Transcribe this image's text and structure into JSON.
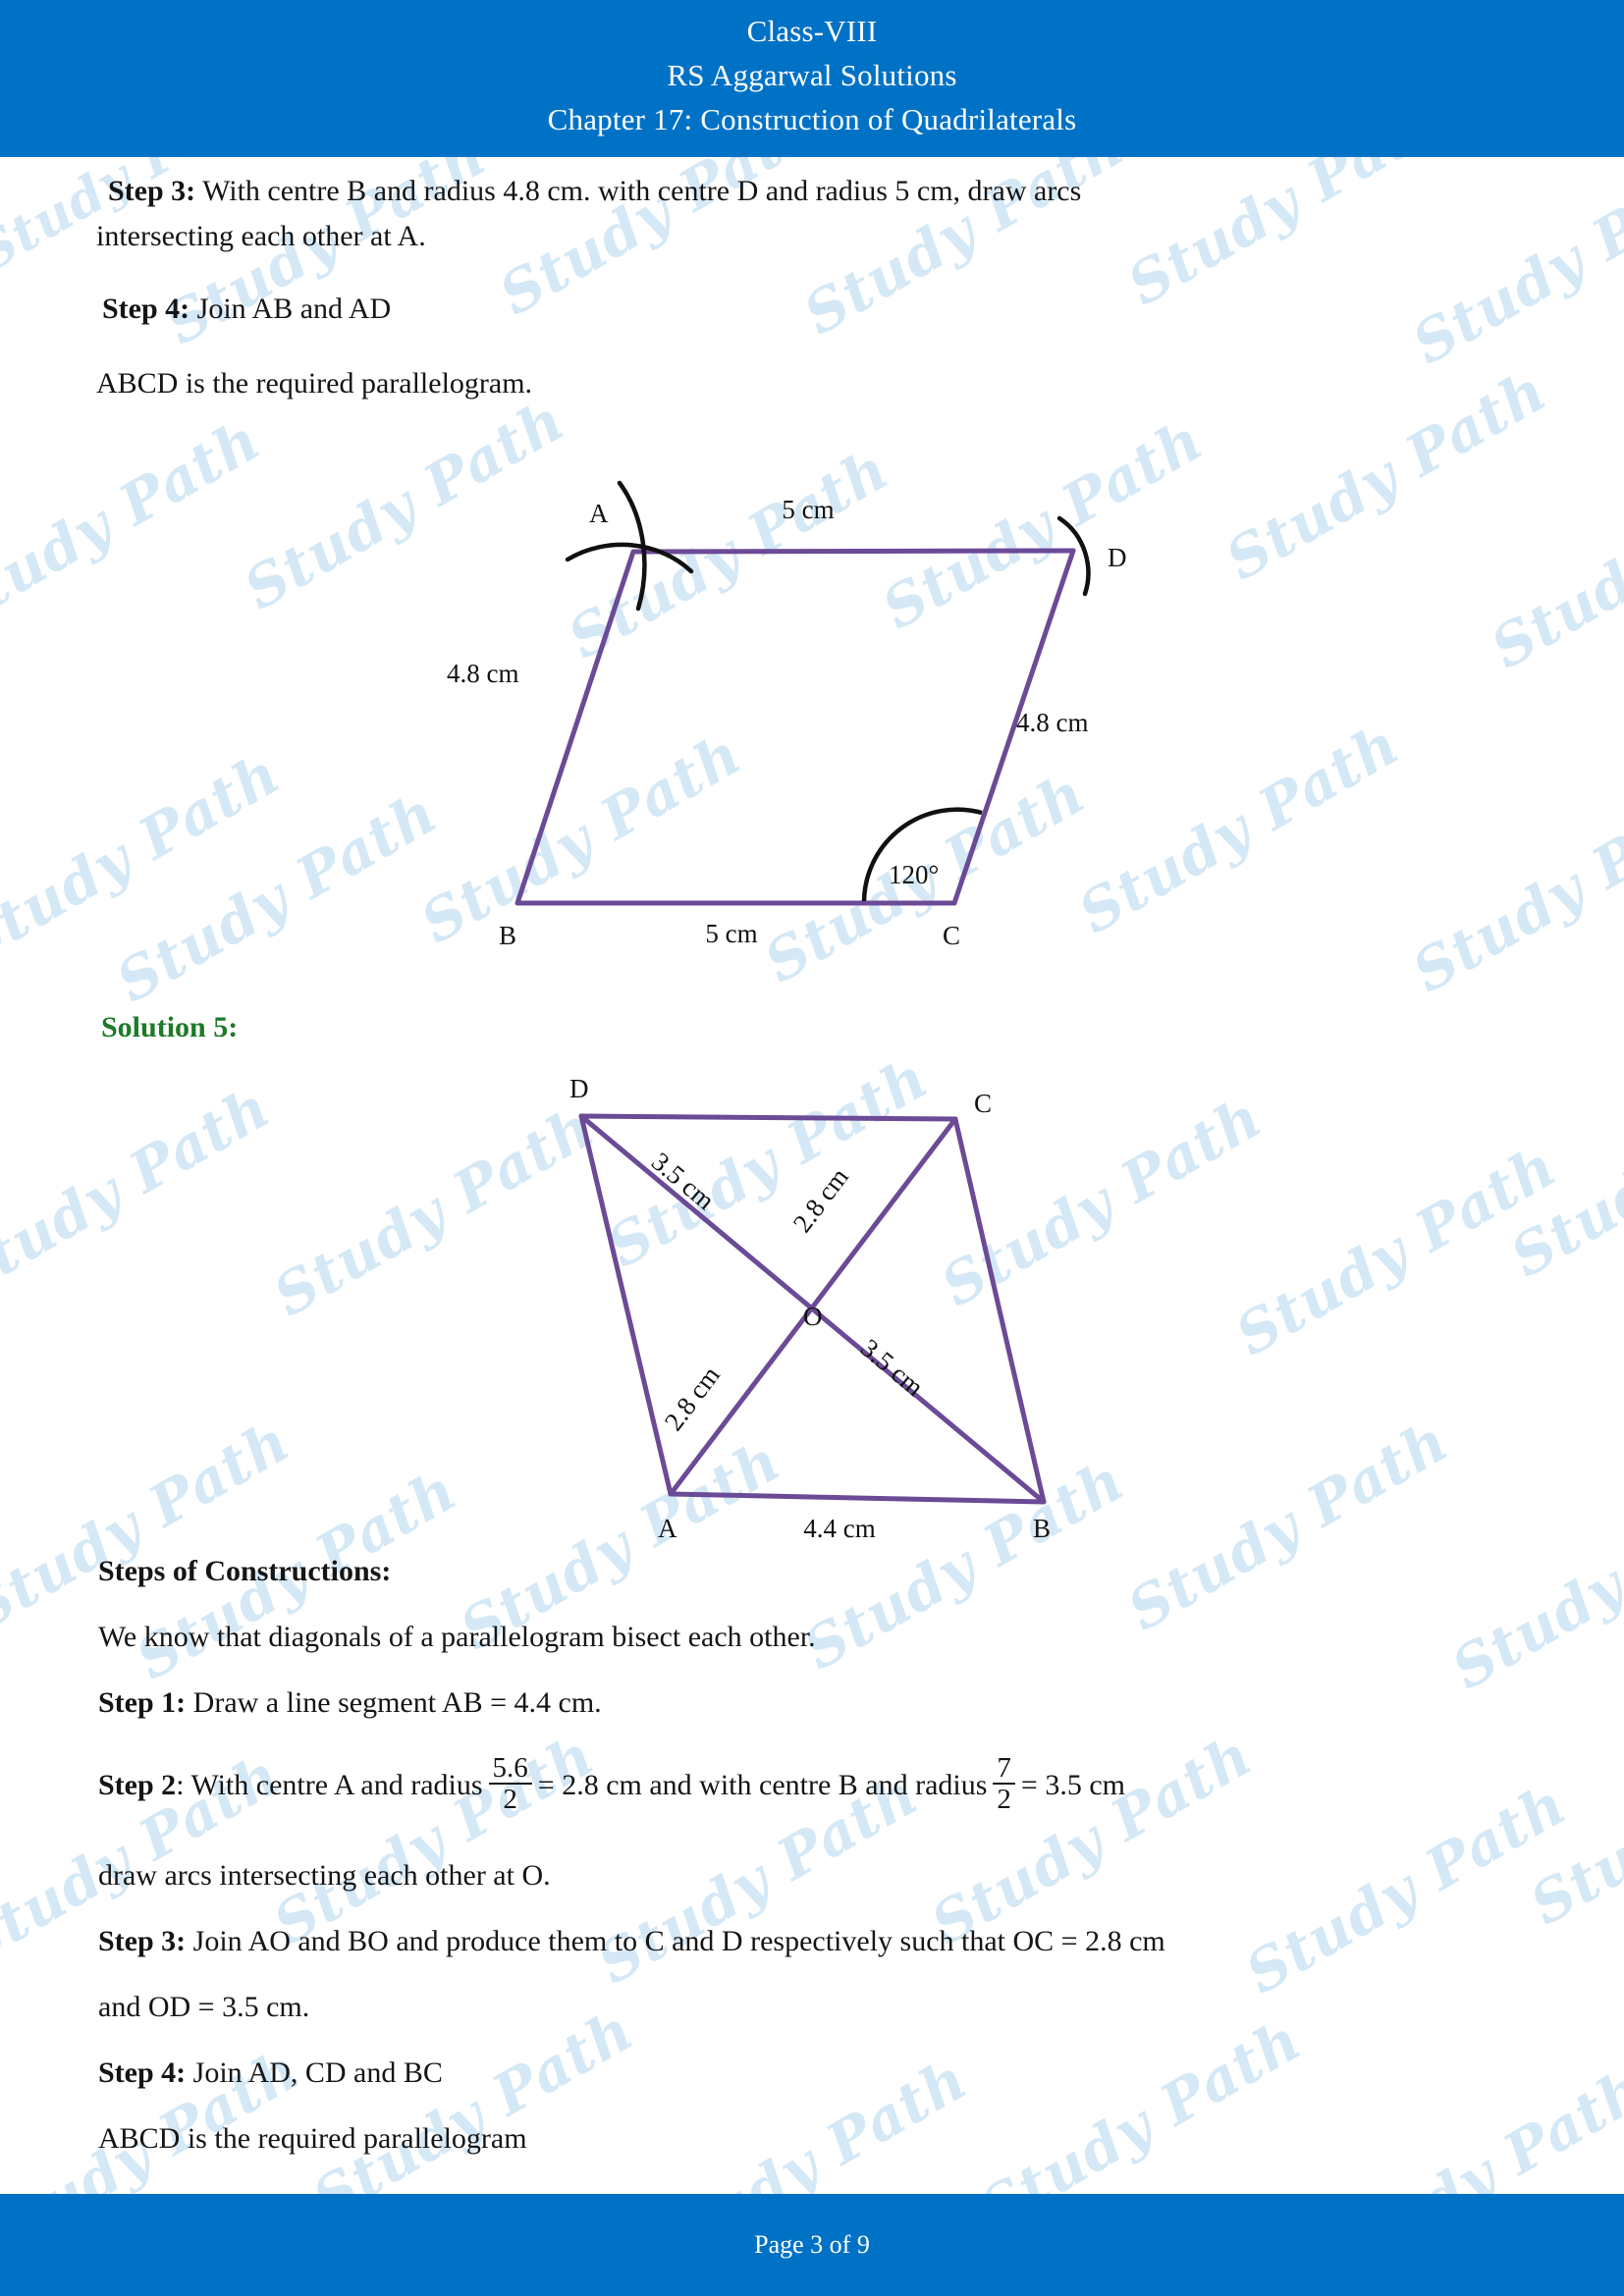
{
  "header": {
    "line1": "Class-VIII",
    "line2": "RS Aggarwal Solutions",
    "line3": "Chapter 17: Construction of Quadrilaterals",
    "bar_color": "#0072c6"
  },
  "footer": {
    "page_text": "Page 3 of 9",
    "page_current": "3",
    "page_total": "9",
    "bar_color": "#0072c6"
  },
  "watermark": {
    "text": "Study Path",
    "color": "#cde4f5"
  },
  "colors": {
    "figure_stroke": "#6b4a96",
    "arc_stroke": "#111111",
    "solution_heading": "#1d7a27",
    "body_text": "#151515"
  },
  "body": {
    "step3_top_line1": "Step 3: With centre B and radius 4.8 cm. with centre D and radius 5 cm, draw arcs",
    "step3_top_line2": "intersecting each other at A.",
    "step3_top_label": "Step 3:",
    "step3_top_rest1": " With centre B and radius 4.8 cm. with centre D and radius 5 cm, draw arcs",
    "step4_top_label": "Step 4:",
    "step4_top_rest": " Join AB and AD",
    "conclusion_top": "ABCD is the required parallelogram.",
    "solution_heading": "Solution 5:",
    "steps_heading": "Steps of Constructions:",
    "intro_line": "We know that diagonals of a parallelogram bisect each other.",
    "step1_label": "Step 1:",
    "step1_rest": " Draw a line segment AB = 4.4 cm.",
    "step2_label": "Step 2",
    "step2_part1": ": With centre A and radius ",
    "step2_frac1_num": "5.6",
    "step2_frac1_den": "2",
    "step2_part2": " = 2.8 cm and with centre B and radius ",
    "step2_frac2_num": "7",
    "step2_frac2_den": "2",
    "step2_part3": " =  3.5 cm",
    "step2_cont": "draw arcs intersecting each other at O.",
    "step3_label": "Step 3:",
    "step3_rest": " Join AO and BO and produce them to C and D respectively such that OC = 2.8 cm",
    "step3_cont": "and OD = 3.5 cm.",
    "step4_label": "Step 4:",
    "step4_rest": " Join AD, CD and BC",
    "conclusion_bottom": "ABCD is the required parallelogram"
  },
  "figure1": {
    "name": "parallelogram-abcd-120deg",
    "vertex_labels": {
      "A": "A",
      "B": "B",
      "C": "C",
      "D": "D"
    },
    "dim_top": "5 cm",
    "dim_left": "4.8 cm",
    "dim_right": "4.8 cm",
    "dim_bottom": "5 cm",
    "angle_label": "120°"
  },
  "figure2": {
    "name": "parallelogram-abcd-diagonals",
    "vertex_labels": {
      "A": "A",
      "B": "B",
      "C": "C",
      "D": "D",
      "O": "O"
    },
    "dim_do": "3.5 cm",
    "dim_oc": "2.8 cm",
    "dim_ao": "2.8 cm",
    "dim_ob": "3.5 cm",
    "dim_ab": "4.4 cm"
  }
}
